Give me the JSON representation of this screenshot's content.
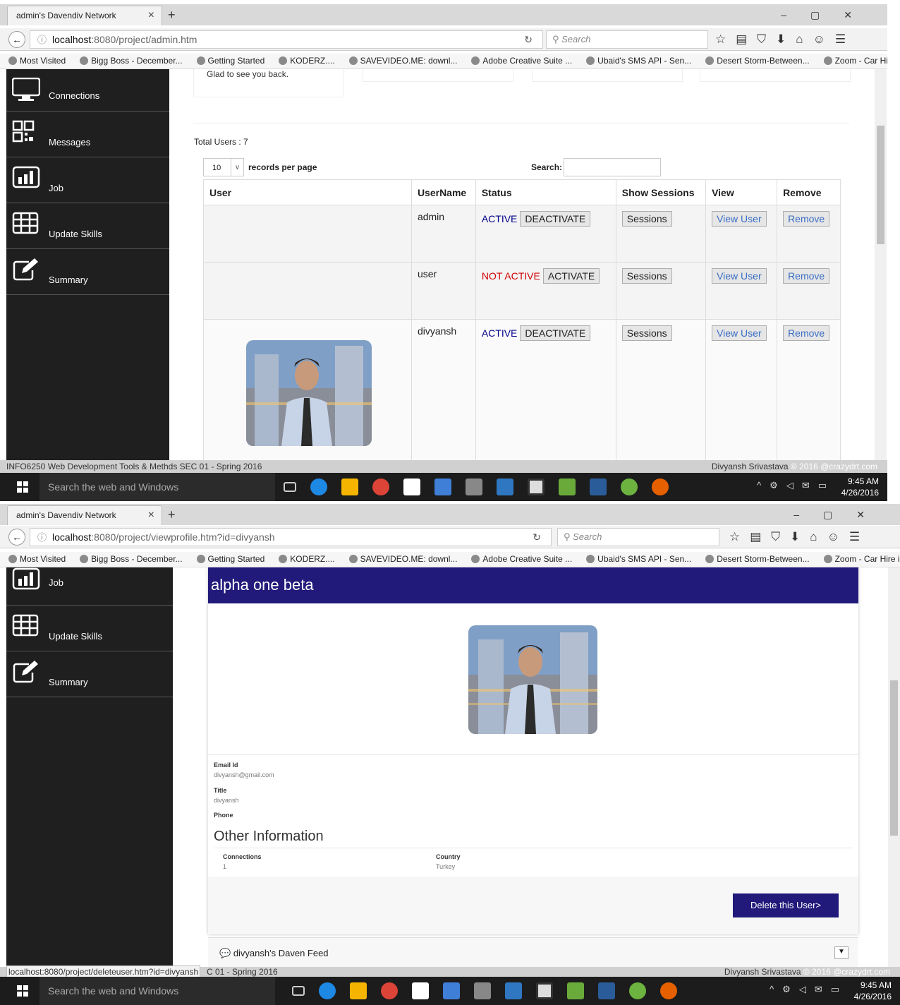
{
  "shot1": {
    "tab_title": "admin's Davendiv Network",
    "url_host": "localhost",
    "url_rest": ":8080/project/admin.htm",
    "search_placeholder": "Search",
    "bookmarks": [
      "Most Visited",
      "Bigg Boss - December...",
      "Getting Started",
      "KODERZ....",
      "SAVEVIDEO.ME: downl...",
      "Adobe Creative Suite ...",
      "Ubaid's SMS API - Sen...",
      "Desert Storm-Between...",
      "Zoom - Car Hire in Ba..."
    ],
    "sidebar": [
      {
        "label": "Connections",
        "icon": "monitor-icon"
      },
      {
        "label": "Messages",
        "icon": "qr-icon"
      },
      {
        "label": "Job",
        "icon": "bar-chart-icon"
      },
      {
        "label": "Update Skills",
        "icon": "grid-icon"
      },
      {
        "label": "Summary",
        "icon": "edit-icon"
      }
    ],
    "greeting": "Glad to see you back.",
    "total_users": "Total Users : 7",
    "records_value": "10",
    "records_label": "records per page",
    "search_label": "Search:",
    "columns": [
      "User",
      "UserName",
      "Status",
      "Show Sessions",
      "View",
      "Remove"
    ],
    "rows": [
      {
        "username": "admin",
        "status": "ACTIVE",
        "status_kind": "active",
        "action": "DEACTIVATE",
        "sessions": "Sessions",
        "view": "View User",
        "remove": "Remove",
        "has_photo": false
      },
      {
        "username": "user",
        "status": "NOT ACTIVE",
        "status_kind": "notactive",
        "action": "ACTIVATE",
        "sessions": "Sessions",
        "view": "View User",
        "remove": "Remove",
        "has_photo": false
      },
      {
        "username": "divyansh",
        "status": "ACTIVE",
        "status_kind": "active",
        "action": "DEACTIVATE",
        "sessions": "Sessions",
        "view": "View User",
        "remove": "Remove",
        "has_photo": true
      }
    ],
    "status_left": "INFO6250 Web Development Tools & Methds SEC 01 - Spring 2016",
    "status_right_name": "Divyansh Srivastava",
    "status_right_copy": "© 2016 @crazydrt.com",
    "taskbar_search": "Search the web and Windows",
    "clock_time": "9:45 AM",
    "clock_date": "4/26/2016"
  },
  "shot2": {
    "tab_title": "admin's Davendiv Network",
    "url_host": "localhost",
    "url_rest": ":8080/project/viewprofile.htm?id=divyansh",
    "search_placeholder": "Search",
    "sidebar": [
      {
        "label": "Job",
        "icon": "bar-chart-icon"
      },
      {
        "label": "Update Skills",
        "icon": "grid-icon"
      },
      {
        "label": "Summary",
        "icon": "edit-icon"
      }
    ],
    "profile_name": "alpha one beta",
    "email_label": "Email Id",
    "email_value": "divyansh@gmail.com",
    "title_label": "Title",
    "title_value": "divyansh",
    "phone_label": "Phone",
    "other_heading": "Other Information",
    "connections_label": "Connections",
    "connections_value": "1",
    "country_label": "Country",
    "country_value": "Turkey",
    "delete_button": "Delete this User>",
    "feed_label": "divyansh's Daven Feed",
    "status_link": "localhost:8080/project/deleteuser.htm?id=divyansh",
    "status_left_tail": "C 01 - Spring 2016",
    "status_right_name": "Divyansh Srivastava",
    "status_right_copy": "© 2016 @crazydrt.com",
    "taskbar_search": "Search the web and Windows",
    "clock_time": "9:45 AM",
    "clock_date": "4/26/2016"
  },
  "colors": {
    "sidebar_bg": "#1f1f1f",
    "title_bar": "#211a7a",
    "active": "#00008b",
    "not_active": "#d00000",
    "link": "#3b6ec4"
  }
}
